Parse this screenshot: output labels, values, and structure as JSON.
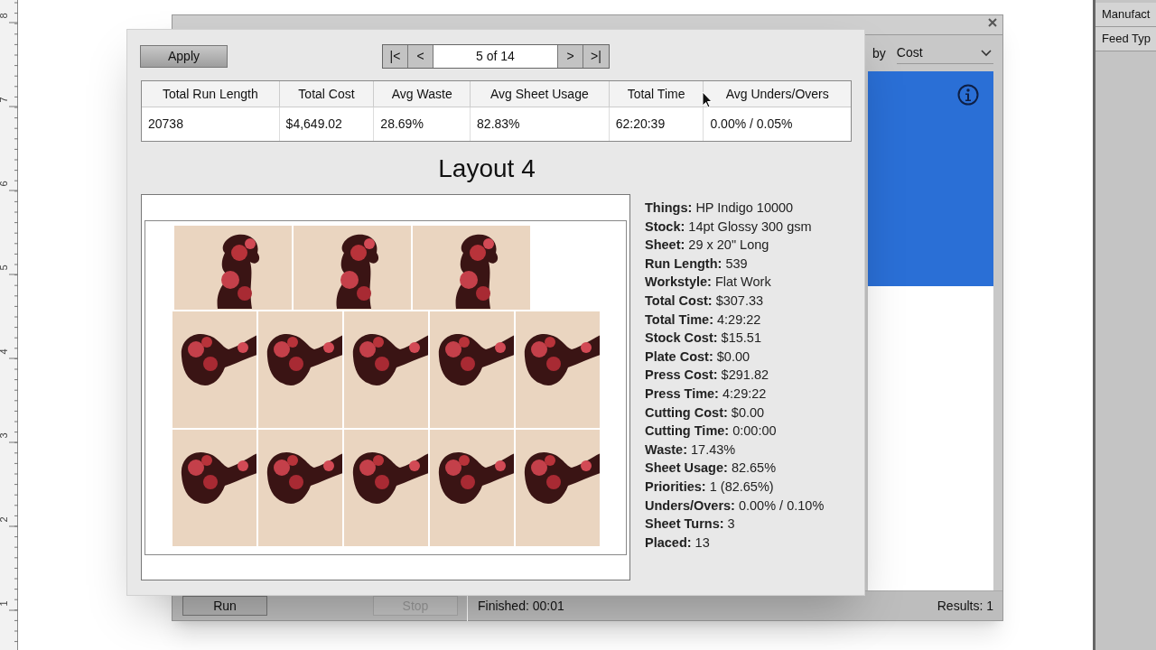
{
  "ruler": {
    "labels": [
      "8",
      "7",
      "6",
      "5",
      "4",
      "3",
      "2",
      "1"
    ]
  },
  "back_window": {
    "sort_label": "by",
    "sort_value": "Cost",
    "buttons": [
      {
        "label": "Run",
        "disabled": false
      },
      {
        "label": "Stop",
        "disabled": true
      }
    ],
    "status": "Finished: 00:01",
    "results": "Results: 1"
  },
  "side_panel": {
    "rows": [
      "Manufact",
      "Feed Typ"
    ]
  },
  "popup": {
    "apply": "Apply",
    "nav": {
      "first": "|<",
      "prev": "<",
      "page": "5 of 14",
      "next": ">",
      "last": ">|"
    },
    "table": {
      "columns": [
        "Total Run Length",
        "Total Cost",
        "Avg Waste",
        "Avg Sheet Usage",
        "Total Time",
        "Avg Unders/Overs"
      ],
      "rows": [
        [
          "20738",
          "$4,649.02",
          "28.69%",
          "82.83%",
          "62:20:39",
          "0.00% / 0.05%"
        ]
      ]
    },
    "layout_title": "Layout 4",
    "details": [
      "**Things:** HP Indigo 10000",
      "**Stock:** 14pt Glossy 300 gsm",
      "**Sheet:** 29 x 20\" Long",
      "**Run Length:** 539",
      "**Workstyle:** Flat Work",
      "**Total Cost:** $307.33",
      "**Total Time:** 4:29:22",
      "**Stock Cost:** $15.51",
      "**Plate Cost:** $0.00",
      "**Press Cost:** $291.82",
      "**Press Time:** 4:29:22",
      "**Cutting Cost:** $0.00",
      "**Cutting Time:** 0:00:00",
      "**Waste:** 17.43%",
      "**Sheet Usage:** 82.65%",
      "**Priorities:** 1 (82.65%)",
      "**Unders/Overs:** 0.00% / 0.10%",
      "**Sheet Turns:** 3",
      "**Placed:** 13"
    ]
  }
}
